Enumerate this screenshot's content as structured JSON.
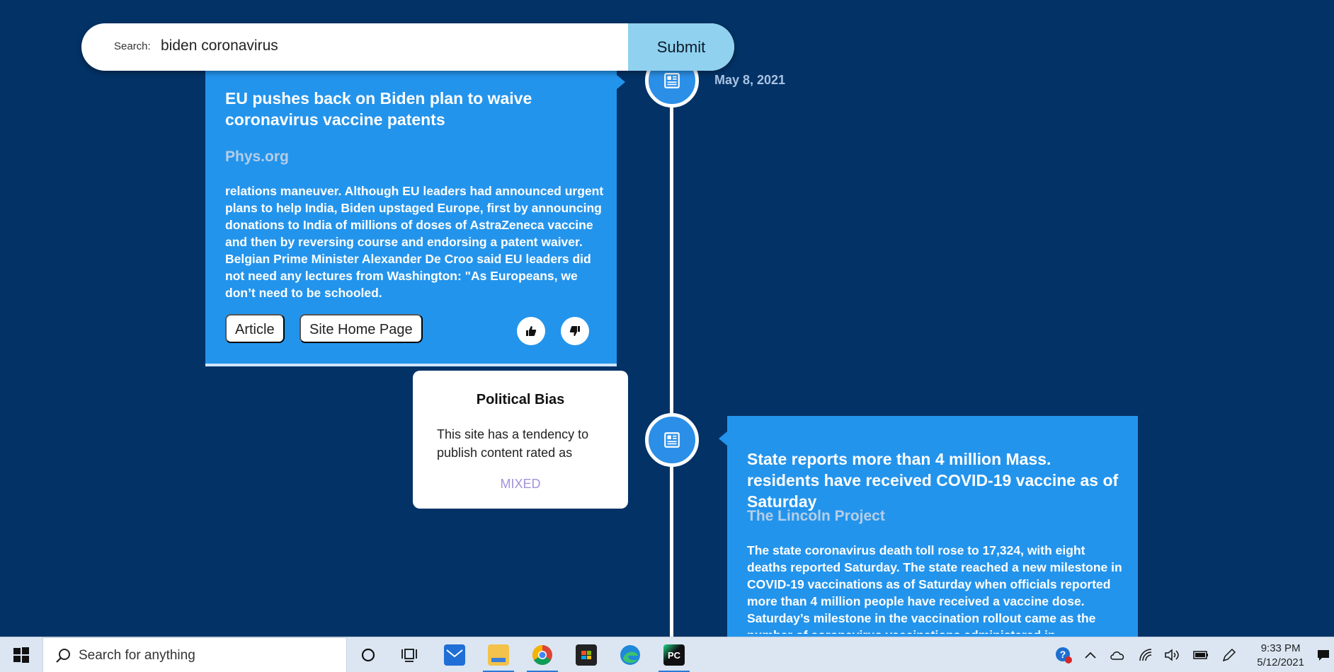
{
  "search": {
    "label": "Search:",
    "value": "biden coronavirus",
    "submit_label": "Submit"
  },
  "timeline": {
    "items": [
      {
        "date": "May 8, 2021",
        "title": "EU pushes back on Biden plan to waive coronavirus vaccine patents",
        "source": "Phys.org",
        "body": "relations maneuver. Although EU leaders had announced urgent plans to help India, Biden upstaged Europe, first by announcing donations to India of millions of doses of AstraZeneca vaccine and then by reversing course and endorsing a patent waiver. Belgian Prime Minister Alexander De Croo said EU leaders did not need any lectures from Washington: \"As Europeans, we don’t need to be schooled.",
        "article_label": "Article",
        "home_label": "Site Home Page"
      },
      {
        "title": "State reports more than 4 million Mass. residents have received COVID-19 vaccine as of Saturday",
        "source": "The Lincoln Project",
        "body": "The state coronavirus death toll rose to 17,324, with eight deaths reported Saturday. The state reached a new milestone in COVID-19 vaccinations as of Saturday when officials reported more than 4 million people have received a vaccine dose. Saturday’s milestone in the vaccination rollout came as the number of coronavirus vaccinations administered in"
      }
    ]
  },
  "bias": {
    "title": "Political Bias",
    "text": "This site has a tendency to publish content rated as",
    "rating": "MIXED"
  },
  "taskbar": {
    "search_placeholder": "Search for anything",
    "apps": [
      "cortana-icon",
      "task-view-icon",
      "mail-icon",
      "file-explorer-icon",
      "chrome-icon",
      "store-icon",
      "edge-icon",
      "pycharm-icon"
    ],
    "time": "9:33 PM",
    "date": "5/12/2021"
  },
  "colors": {
    "background": "#033266",
    "card": "#2394ec",
    "submit": "#8fd1ef",
    "rating": "#a393d9"
  }
}
